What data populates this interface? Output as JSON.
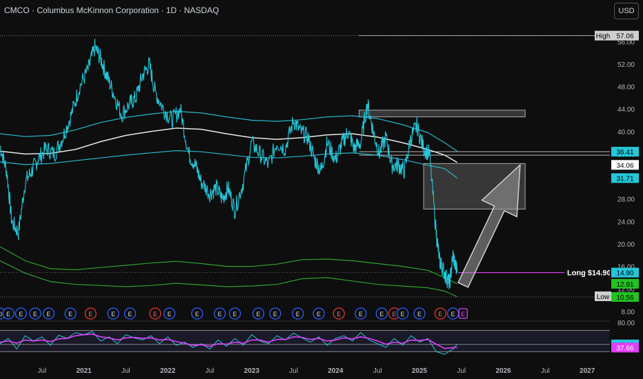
{
  "header": {
    "title": "CMCO · Columbus McKinnon Corporation · 1D · NASDAQ",
    "currency": "USD"
  },
  "colors": {
    "price": "#26c6da",
    "white_ma": "#e8e8e8",
    "band": "#27b8cc",
    "green_band": "#2ea12e",
    "rsi": "#26c6da",
    "rsi_ma": "#e040fb",
    "long_line": "#e040fb",
    "arrow": "#9e9e9e"
  },
  "chart_data": {
    "type": "line",
    "title": "CMCO · Columbus McKinnon Corporation · 1D · NASDAQ",
    "ylim": [
      7,
      58
    ],
    "y_ticks": [
      8.0,
      12.0,
      16.0,
      20.0,
      24.0,
      28.0,
      32.0,
      36.0,
      40.0,
      44.0,
      48.0,
      52.0,
      56.0
    ],
    "x_ticks": [
      "Jul",
      "2021",
      "Jul",
      "2022",
      "Jul",
      "2023",
      "Jul",
      "2024",
      "Jul",
      "2025",
      "Jul",
      "2026",
      "Jul",
      "2027"
    ],
    "x_tick_dates": [
      2020.5,
      2021.0,
      2021.5,
      2022.0,
      2022.5,
      2023.0,
      2023.5,
      2024.0,
      2024.5,
      2025.0,
      2025.5,
      2026.0,
      2026.5,
      2027.0
    ],
    "xlim": [
      2020.0,
      2027.27
    ],
    "price_series": {
      "dates": [
        2020.0,
        2020.08,
        2020.14,
        2020.22,
        2020.3,
        2020.38,
        2020.45,
        2020.55,
        2020.65,
        2020.75,
        2020.85,
        2020.95,
        2021.05,
        2021.13,
        2021.2,
        2021.27,
        2021.35,
        2021.45,
        2021.55,
        2021.62,
        2021.7,
        2021.78,
        2021.85,
        2021.95,
        2022.05,
        2022.15,
        2022.25,
        2022.33,
        2022.4,
        2022.5,
        2022.58,
        2022.65,
        2022.72,
        2022.8,
        2022.9,
        2023.0,
        2023.1,
        2023.2,
        2023.3,
        2023.4,
        2023.5,
        2023.58,
        2023.67,
        2023.75,
        2023.83,
        2023.9,
        2024.0,
        2024.08,
        2024.15,
        2024.22,
        2024.3,
        2024.38,
        2024.45,
        2024.52,
        2024.6,
        2024.67,
        2024.75,
        2024.82,
        2024.9,
        2024.97,
        2025.05,
        2025.12,
        2025.2,
        2025.24,
        2025.27,
        2025.32,
        2025.36,
        2025.4,
        2025.45
      ],
      "values": [
        37.5,
        33,
        24,
        22,
        31,
        33,
        35,
        37,
        36,
        39,
        43,
        48,
        51,
        55,
        53,
        50,
        47,
        43,
        45,
        46,
        50,
        52,
        47,
        44,
        42,
        44,
        36,
        34,
        31,
        29,
        30,
        28,
        30,
        26,
        31,
        38,
        36,
        34,
        38,
        37,
        42,
        40,
        39,
        35,
        33,
        38,
        35,
        38,
        40,
        37,
        38,
        45,
        40,
        36,
        39,
        34,
        34,
        33,
        39,
        41,
        37,
        36,
        22,
        17,
        16,
        14,
        13,
        18,
        14.9
      ]
    },
    "ma_white": {
      "dates": [
        2020.0,
        2020.3,
        2020.6,
        2020.9,
        2021.2,
        2021.5,
        2021.8,
        2022.1,
        2022.4,
        2022.7,
        2023.0,
        2023.3,
        2023.6,
        2023.9,
        2024.2,
        2024.5,
        2024.8,
        2025.1,
        2025.3,
        2025.45
      ],
      "values": [
        36.5,
        36.0,
        36.1,
        36.8,
        38.2,
        39.3,
        40.0,
        40.6,
        40.4,
        39.6,
        38.9,
        38.6,
        38.9,
        39.4,
        39.6,
        39.0,
        38.0,
        36.8,
        35.8,
        34.5
      ]
    },
    "band_upper": {
      "dates": [
        2020.0,
        2020.3,
        2020.6,
        2020.9,
        2021.2,
        2021.5,
        2021.8,
        2022.1,
        2022.4,
        2022.7,
        2023.0,
        2023.3,
        2023.6,
        2023.9,
        2024.2,
        2024.5,
        2024.8,
        2025.1,
        2025.3,
        2025.45
      ],
      "values": [
        39.6,
        39.1,
        39.3,
        40.3,
        41.6,
        42.5,
        43.1,
        43.6,
        43.3,
        42.6,
        42.0,
        41.8,
        42.1,
        42.6,
        42.8,
        42.3,
        41.2,
        39.8,
        38.0,
        36.5
      ]
    },
    "band_lower": {
      "dates": [
        2020.0,
        2020.3,
        2020.6,
        2020.9,
        2021.2,
        2021.5,
        2021.8,
        2022.1,
        2022.4,
        2022.7,
        2023.0,
        2023.3,
        2023.6,
        2023.9,
        2024.2,
        2024.5,
        2024.8,
        2025.1,
        2025.3,
        2025.45
      ],
      "values": [
        34.6,
        34.1,
        34.3,
        34.8,
        35.3,
        35.8,
        36.2,
        36.6,
        36.4,
        35.9,
        35.4,
        35.3,
        35.6,
        36.0,
        36.2,
        35.8,
        35.0,
        34.0,
        33.4,
        31.7
      ]
    },
    "green_upper": {
      "dates": [
        2020.0,
        2020.3,
        2020.6,
        2020.9,
        2021.2,
        2021.5,
        2021.8,
        2022.1,
        2022.4,
        2022.7,
        2023.0,
        2023.3,
        2023.6,
        2023.9,
        2024.2,
        2024.5,
        2024.8,
        2025.1,
        2025.3,
        2025.45
      ],
      "values": [
        19.5,
        17.0,
        15.6,
        15.4,
        15.8,
        16.2,
        16.6,
        16.9,
        16.5,
        16.0,
        16.0,
        16.4,
        17.2,
        17.3,
        17.0,
        16.5,
        16.0,
        15.3,
        14.0,
        12.9
      ]
    },
    "green_lower": {
      "dates": [
        2020.0,
        2020.3,
        2020.6,
        2020.9,
        2021.2,
        2021.5,
        2021.8,
        2022.1,
        2022.4,
        2022.7,
        2023.0,
        2023.3,
        2023.6,
        2023.9,
        2024.2,
        2024.5,
        2024.8,
        2025.1,
        2025.3,
        2025.45
      ],
      "values": [
        17.0,
        14.8,
        13.3,
        12.8,
        12.6,
        12.4,
        12.6,
        13.0,
        12.7,
        12.4,
        12.5,
        12.8,
        13.8,
        14.0,
        13.4,
        12.8,
        12.5,
        12.2,
        11.6,
        10.6
      ]
    },
    "zones": [
      {
        "x0": 2024.28,
        "x1": 2026.26,
        "y0": 42.6,
        "y1": 43.8
      },
      {
        "x0": 2025.05,
        "x1": 2026.26,
        "y0": 26.2,
        "y1": 34.3
      }
    ],
    "level_lines": [
      57.06,
      36.41,
      35.8
    ],
    "high_label": {
      "text": "High",
      "value": "57.06",
      "price": 57.06
    },
    "low_label": {
      "text": "Low",
      "value": "10.56",
      "price": 10.56
    },
    "long_label": {
      "text": "Long $14.90",
      "price": 14.9
    },
    "arrow": {
      "from": [
        2025.52,
        12.7
      ],
      "to": [
        2026.2,
        34.06
      ]
    },
    "price_badges": [
      {
        "text": "36.41",
        "price": 36.41,
        "bg": "#26c6da",
        "fg": "#000000"
      },
      {
        "text": "34.06",
        "price": 34.06,
        "bg": "#ffffff",
        "fg": "#000000"
      },
      {
        "text": "31.71",
        "price": 31.71,
        "bg": "#26c6da",
        "fg": "#000000"
      },
      {
        "text": "14.90",
        "price": 14.9,
        "bg": "#26c6da",
        "fg": "#000000"
      },
      {
        "text": "12.91",
        "price": 12.91,
        "bg": "#22c322",
        "fg": "#000000"
      },
      {
        "text": "10.56",
        "price": 10.56,
        "bg": "#22c322",
        "fg": "#000000"
      }
    ],
    "events": {
      "dates": [
        2020.0,
        2020.1,
        2020.25,
        2020.42,
        2020.58,
        2020.84,
        2021.08,
        2021.35,
        2021.55,
        2021.85,
        2022.02,
        2022.35,
        2022.62,
        2022.8,
        2023.08,
        2023.28,
        2023.55,
        2023.8,
        2024.04,
        2024.3,
        2024.55,
        2024.7,
        2024.8,
        2025.0,
        2025.25,
        2025.4,
        2025.52
      ],
      "labels": [
        "D",
        "E",
        "E",
        "E",
        "E",
        "E",
        "E",
        "E",
        "E",
        "E",
        "E",
        "E",
        "E",
        "E",
        "E",
        "E",
        "E",
        "E",
        "E",
        "E",
        "E",
        "E",
        "E",
        "E",
        "E",
        "E",
        "E"
      ],
      "kinds": [
        "div",
        "earn",
        "earn",
        "earn",
        "earn",
        "earn",
        "earn-red",
        "earn",
        "earn",
        "earn-red",
        "earn",
        "earn",
        "earn",
        "earn",
        "earn",
        "earn",
        "earn",
        "earn",
        "earn-red",
        "earn",
        "earn",
        "earn-red",
        "earn",
        "earn",
        "earn-red",
        "earn",
        "earn-mag"
      ]
    },
    "rsi": {
      "ylim": [
        20,
        85
      ],
      "axis_ticks": [
        "80.00"
      ],
      "upper": 70,
      "lower": 30,
      "dates": [
        2020.0,
        2020.1,
        2020.2,
        2020.3,
        2020.4,
        2020.5,
        2020.6,
        2020.7,
        2020.8,
        2020.9,
        2021.0,
        2021.1,
        2021.2,
        2021.3,
        2021.4,
        2021.5,
        2021.6,
        2021.7,
        2021.8,
        2021.9,
        2022.0,
        2022.1,
        2022.2,
        2022.3,
        2022.4,
        2022.5,
        2022.6,
        2022.7,
        2022.8,
        2022.9,
        2023.0,
        2023.1,
        2023.2,
        2023.3,
        2023.4,
        2023.5,
        2023.6,
        2023.7,
        2023.8,
        2023.9,
        2024.0,
        2024.1,
        2024.2,
        2024.3,
        2024.4,
        2024.5,
        2024.6,
        2024.7,
        2024.8,
        2024.9,
        2025.0,
        2025.1,
        2025.2,
        2025.3,
        2025.4,
        2025.45
      ],
      "values": [
        45,
        55,
        35,
        60,
        50,
        58,
        42,
        61,
        55,
        66,
        62,
        68,
        50,
        58,
        45,
        62,
        56,
        52,
        60,
        45,
        58,
        42,
        48,
        38,
        45,
        35,
        52,
        40,
        55,
        42,
        62,
        50,
        45,
        60,
        52,
        65,
        56,
        48,
        58,
        42,
        55,
        60,
        50,
        66,
        52,
        45,
        38,
        55,
        42,
        60,
        48,
        55,
        30,
        25,
        35,
        43.66
      ],
      "ma_values": [
        48,
        50,
        46,
        52,
        50,
        52,
        49,
        54,
        55,
        60,
        62,
        63,
        58,
        56,
        52,
        56,
        57,
        55,
        56,
        52,
        53,
        49,
        46,
        42,
        43,
        40,
        45,
        44,
        48,
        46,
        52,
        52,
        48,
        53,
        53,
        58,
        57,
        53,
        55,
        50,
        52,
        56,
        54,
        58,
        55,
        50,
        44,
        48,
        46,
        52,
        51,
        53,
        44,
        36,
        37.66,
        37.66
      ],
      "badges": [
        {
          "text": "43.66",
          "value": 43.66,
          "bg": "#26c6da",
          "fg": "#000000"
        },
        {
          "text": "37.66",
          "value": 37.66,
          "bg": "#e040fb",
          "fg": "#ffffff"
        }
      ]
    }
  }
}
